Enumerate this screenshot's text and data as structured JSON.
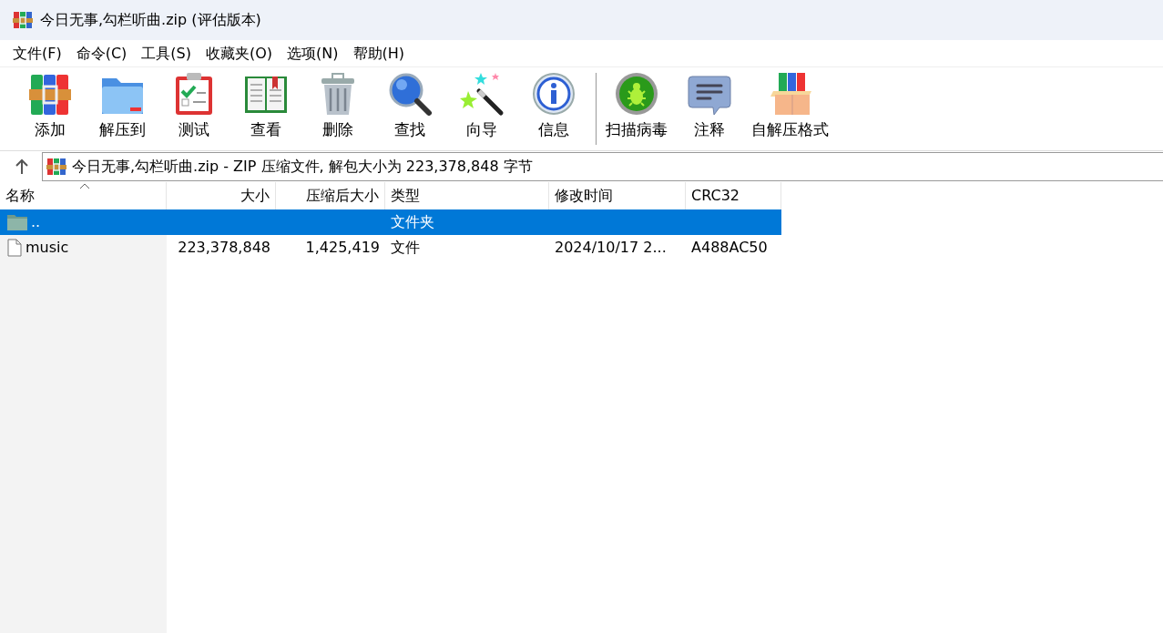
{
  "window": {
    "title": "今日无事,勾栏听曲.zip (评估版本)"
  },
  "menu": [
    "文件(F)",
    "命令(C)",
    "工具(S)",
    "收藏夹(O)",
    "选项(N)",
    "帮助(H)"
  ],
  "toolbar": [
    {
      "label": "添加"
    },
    {
      "label": "解压到"
    },
    {
      "label": "测试"
    },
    {
      "label": "查看"
    },
    {
      "label": "删除"
    },
    {
      "label": "查找"
    },
    {
      "label": "向导"
    },
    {
      "label": "信息"
    },
    {
      "label": "扫描病毒"
    },
    {
      "label": "注释"
    },
    {
      "label": "自解压格式"
    }
  ],
  "address": "今日无事,勾栏听曲.zip - ZIP 压缩文件, 解包大小为 223,378,848 字节",
  "table": {
    "columns": [
      {
        "label": "名称"
      },
      {
        "label": "大小"
      },
      {
        "label": "压缩后大小"
      },
      {
        "label": "类型"
      },
      {
        "label": "修改时间"
      },
      {
        "label": "CRC32"
      }
    ],
    "rows": [
      {
        "kind": "folder",
        "selected": true,
        "cells": [
          "..",
          "",
          "",
          "文件夹",
          "",
          ""
        ]
      },
      {
        "kind": "file",
        "selected": false,
        "cells": [
          "music",
          "223,378,848",
          "1,425,419",
          "文件",
          "2024/10/17 2...",
          "A488AC50"
        ]
      }
    ]
  }
}
